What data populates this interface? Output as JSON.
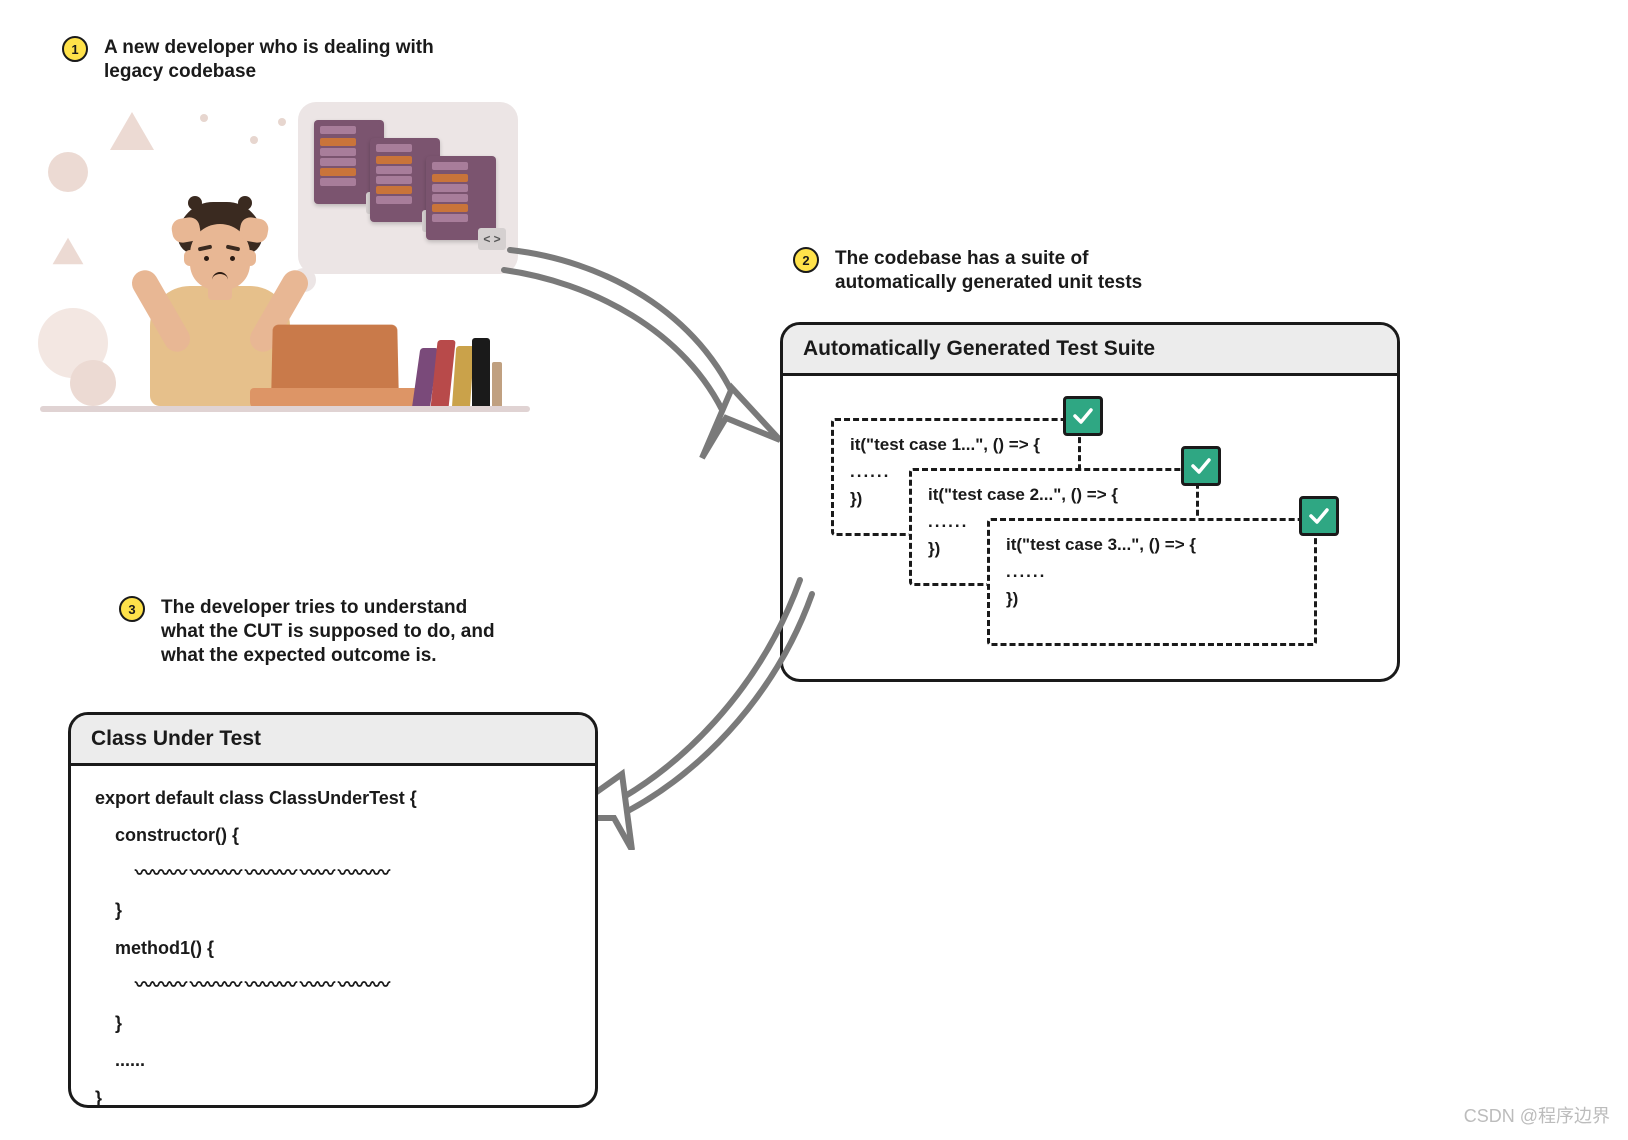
{
  "steps": {
    "s1": {
      "num": "1",
      "text": "A new developer who is dealing with legacy codebase"
    },
    "s2": {
      "num": "2",
      "text": "The codebase has a suite of automatically generated unit tests"
    },
    "s3": {
      "num": "3",
      "text": "The developer tries to understand what the CUT is supposed to do, and what the expected outcome is."
    }
  },
  "bubble": {
    "tag": "< >"
  },
  "testSuite": {
    "title": "Automatically Generated Test Suite",
    "cases": {
      "c1": {
        "head": "it(\"test case 1...\", () => {",
        "mid": "......",
        "end": "})"
      },
      "c2": {
        "head": "it(\"test case 2...\", () => {",
        "mid": "......",
        "end": "})"
      },
      "c3": {
        "head": "it(\"test case 3...\", () => {",
        "mid": "......",
        "end": "})"
      }
    }
  },
  "classPanel": {
    "title": "Class Under Test",
    "l1": "export default class ClassUnderTest {",
    "l2": "    constructor() {",
    "l3": "    }",
    "l4": "    method1() {",
    "l5": "    }",
    "l6": "    ......",
    "l7": "}"
  },
  "watermark": "CSDN @程序边界"
}
